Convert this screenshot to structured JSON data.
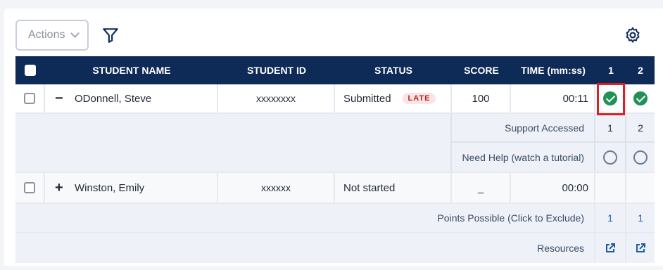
{
  "toolbar": {
    "actions_label": "Actions"
  },
  "headers": {
    "student_name": "STUDENT NAME",
    "student_id": "STUDENT ID",
    "status": "STATUS",
    "score": "SCORE",
    "time": "TIME (mm:ss)",
    "q1": "1",
    "q2": "2"
  },
  "students": [
    {
      "toggle": "−",
      "name": "ODonnell, Steve",
      "id": "xxxxxxxx",
      "status": "Submitted",
      "badge": "LATE",
      "score": "100",
      "time": "00:11",
      "q1": "correct",
      "q2": "correct"
    },
    {
      "toggle": "+",
      "name": "Winston, Emily",
      "id": "xxxxxx",
      "status": "Not started",
      "score": "_",
      "time": "00:00"
    }
  ],
  "details": {
    "support_label": "Support Accessed",
    "support_q1": "1",
    "support_q2": "2",
    "help_label": "Need Help (watch a tutorial)"
  },
  "footer": {
    "points_label": "Points Possible (Click to Exclude)",
    "points_q1": "1",
    "points_q2": "1",
    "resources_label": "Resources"
  },
  "colors": {
    "header_bg": "#0e2a57",
    "correct": "#1f9254",
    "late_badge": "#b42318",
    "highlight": "#e11d24"
  },
  "icons": {
    "filter": "filter-icon",
    "settings": "gear-icon",
    "external": "external-link-icon"
  }
}
